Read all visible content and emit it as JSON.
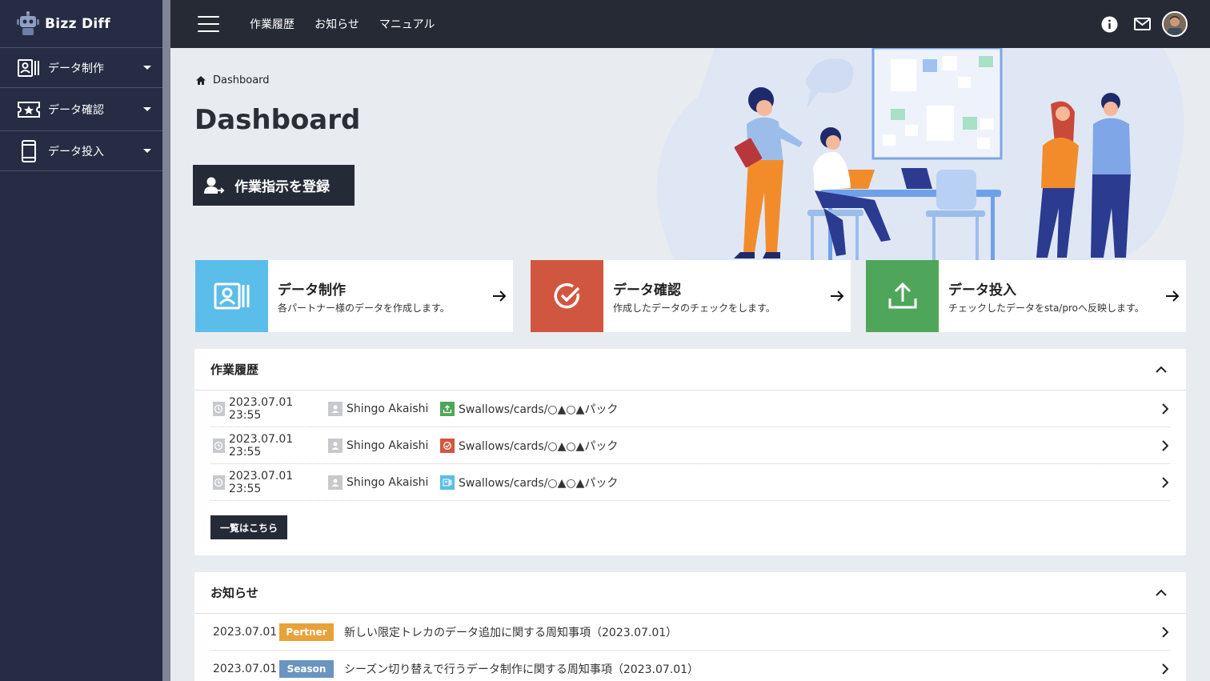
{
  "brand": {
    "name": "Bizz Diff",
    "logo_icon": "robot-icon"
  },
  "sidebar": {
    "items": [
      {
        "label": "データ制作",
        "icon": "id-card-icon"
      },
      {
        "label": "データ確認",
        "icon": "ticket-star-icon"
      },
      {
        "label": "データ投入",
        "icon": "mobile-icon"
      }
    ]
  },
  "topbar": {
    "nav": [
      "作業履歴",
      "お知らせ",
      "マニュアル"
    ],
    "icons": [
      "info-icon",
      "mail-icon",
      "avatar"
    ]
  },
  "breadcrumb": {
    "label": "Dashboard"
  },
  "page": {
    "title": "Dashboard",
    "register_button": "作業指示を登録"
  },
  "cards": [
    {
      "title": "データ制作",
      "desc": "各パートナー様のデータを作成します。",
      "color": "#5bbde9",
      "icon": "id-card-icon"
    },
    {
      "title": "データ確認",
      "desc": "作成したデータのチェックをします。",
      "color": "#d15640",
      "icon": "check-circle-icon"
    },
    {
      "title": "データ投入",
      "desc": "チェックしたデータをsta/proへ反映します。",
      "color": "#4fa65a",
      "icon": "upload-icon"
    }
  ],
  "history": {
    "title": "作業履歴",
    "rows": [
      {
        "date": "2023.07.01 23:55",
        "user": "Shingo Akaishi",
        "path": "Swallows/cards/○▲○▲パック",
        "type_color": "#4fa65a",
        "type_icon": "upload-icon"
      },
      {
        "date": "2023.07.01 23:55",
        "user": "Shingo Akaishi",
        "path": "Swallows/cards/○▲○▲パック",
        "type_color": "#d15640",
        "type_icon": "check-circle-icon"
      },
      {
        "date": "2023.07.01 23:55",
        "user": "Shingo Akaishi",
        "path": "Swallows/cards/○▲○▲パック",
        "type_color": "#5bbde9",
        "type_icon": "id-card-icon"
      }
    ],
    "list_button": "一覧はこちら"
  },
  "news": {
    "title": "お知らせ",
    "rows": [
      {
        "date": "2023.07.01",
        "badge": "Pertner",
        "badge_color": "#e8a23a",
        "title": "新しい限定トレカのデータ追加に関する周知事項（2023.07.01）"
      },
      {
        "date": "2023.07.01",
        "badge": "Season",
        "badge_color": "#6b95c0",
        "title": "シーズン切り替えで行うデータ制作に関する周知事項（2023.07.01）"
      }
    ]
  }
}
